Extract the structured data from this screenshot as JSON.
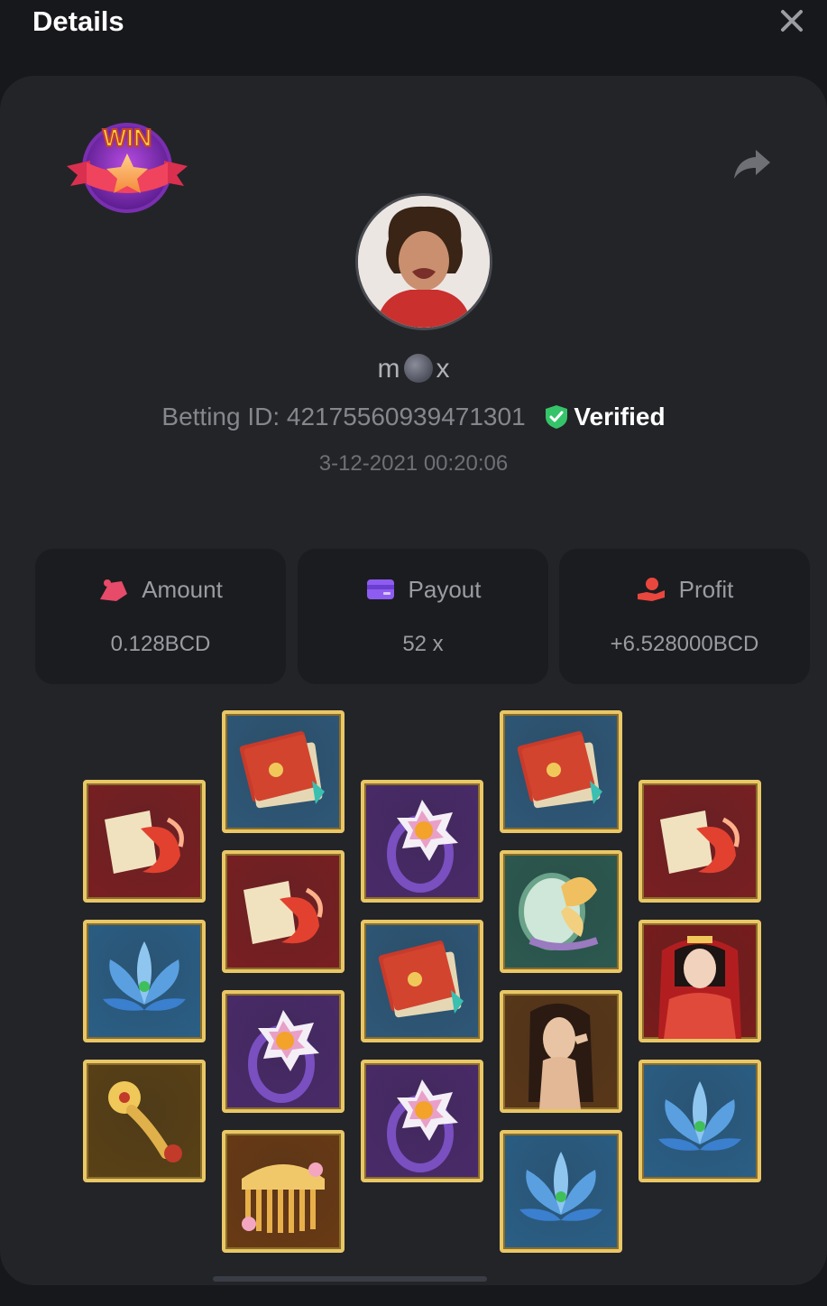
{
  "header": {
    "title": "Details"
  },
  "bet": {
    "username_left": "m",
    "username_right": "x",
    "betting_id_label": "Betting ID:",
    "betting_id": "42175560939471301",
    "verified_label": "Verified",
    "datetime": "3-12-2021 00:20:06"
  },
  "stats": [
    {
      "label": "Amount",
      "value": "0.128BCD",
      "icon": "amount-icon"
    },
    {
      "label": "Payout",
      "value": "52 x",
      "icon": "payout-card-icon"
    },
    {
      "label": "Profit",
      "value": "+6.528000BCD",
      "icon": "profit-hand-icon"
    }
  ],
  "badge": {
    "text": "WIN"
  },
  "colors": {
    "accent_gold": "#e9c766",
    "verified_green": "#35c46a",
    "panel": "#232428",
    "background": "#17181c"
  },
  "reels": [
    [
      "fan-koi",
      "lotus",
      "ruyi-scepter"
    ],
    [
      "book",
      "fan-koi",
      "ring",
      "comb"
    ],
    [
      "ring",
      "book",
      "ring"
    ],
    [
      "book",
      "mirror-butterfly",
      "lady-dark",
      "lotus"
    ],
    [
      "fan-koi",
      "lady-red",
      "lotus"
    ]
  ]
}
